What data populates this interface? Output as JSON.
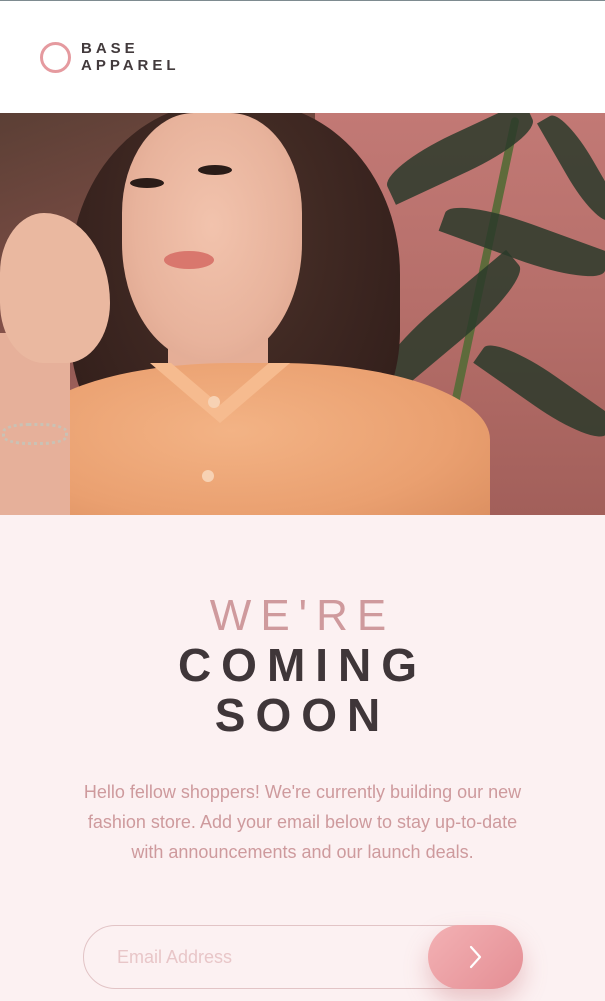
{
  "header": {
    "logo_line1": "BASE",
    "logo_line2": "APPAREL"
  },
  "hero": {
    "image_icon": "portrait-photo"
  },
  "main": {
    "headline_light": "WE'RE",
    "headline_bold_line1": "COMING",
    "headline_bold_line2": "SOON",
    "description": "Hello fellow shoppers! We're currently building our new fashion store. Add your email below to stay up-to-date with announcements and our launch deals."
  },
  "form": {
    "email_placeholder": "Email Address",
    "email_value": "",
    "submit_icon": "chevron-right-icon"
  },
  "colors": {
    "accent": "#e48e94",
    "accent_light": "#f3b1b4",
    "text_dark": "#3f3639",
    "text_pink": "#ce9a9d",
    "background": "#fcf1f2"
  }
}
